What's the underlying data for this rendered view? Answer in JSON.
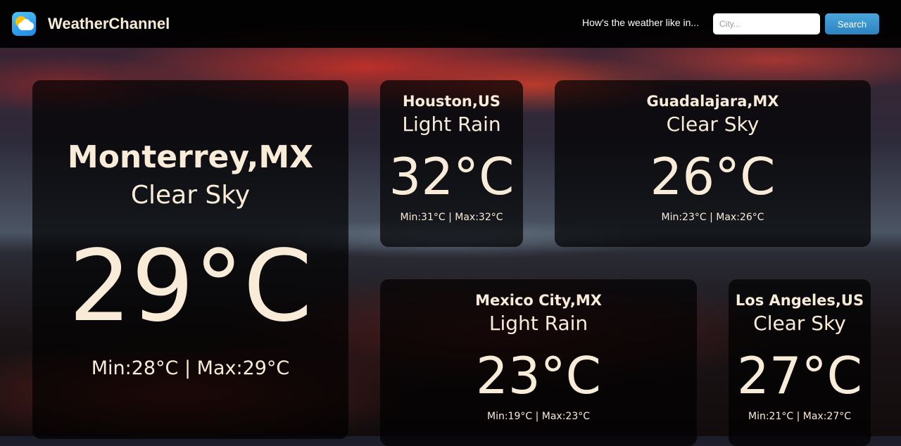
{
  "header": {
    "brand": "WeatherChannel",
    "logo_icon": "weather-sun-cloud-icon",
    "prompt": "How's the weather like in...",
    "search_placeholder": "City...",
    "search_button": "Search"
  },
  "featured": {
    "city": "Monterrey,MX",
    "condition": "Clear Sky",
    "temperature": "29°C",
    "range": "Min:28°C | Max:29°C"
  },
  "cities": [
    {
      "city": "Houston,US",
      "condition": "Light Rain",
      "temperature": "32°C",
      "range": "Min:31°C | Max:32°C"
    },
    {
      "city": "Guadalajara,MX",
      "condition": "Clear Sky",
      "temperature": "26°C",
      "range": "Min:23°C | Max:26°C"
    },
    {
      "city": "Mexico City,MX",
      "condition": "Light Rain",
      "temperature": "23°C",
      "range": "Min:19°C | Max:23°C"
    },
    {
      "city": "Los Angeles,US",
      "condition": "Clear Sky",
      "temperature": "27°C",
      "range": "Min:21°C | Max:27°C"
    }
  ],
  "colors": {
    "text": "#f8ecd9",
    "button": "#3a96d0",
    "navbar": "#000000"
  }
}
